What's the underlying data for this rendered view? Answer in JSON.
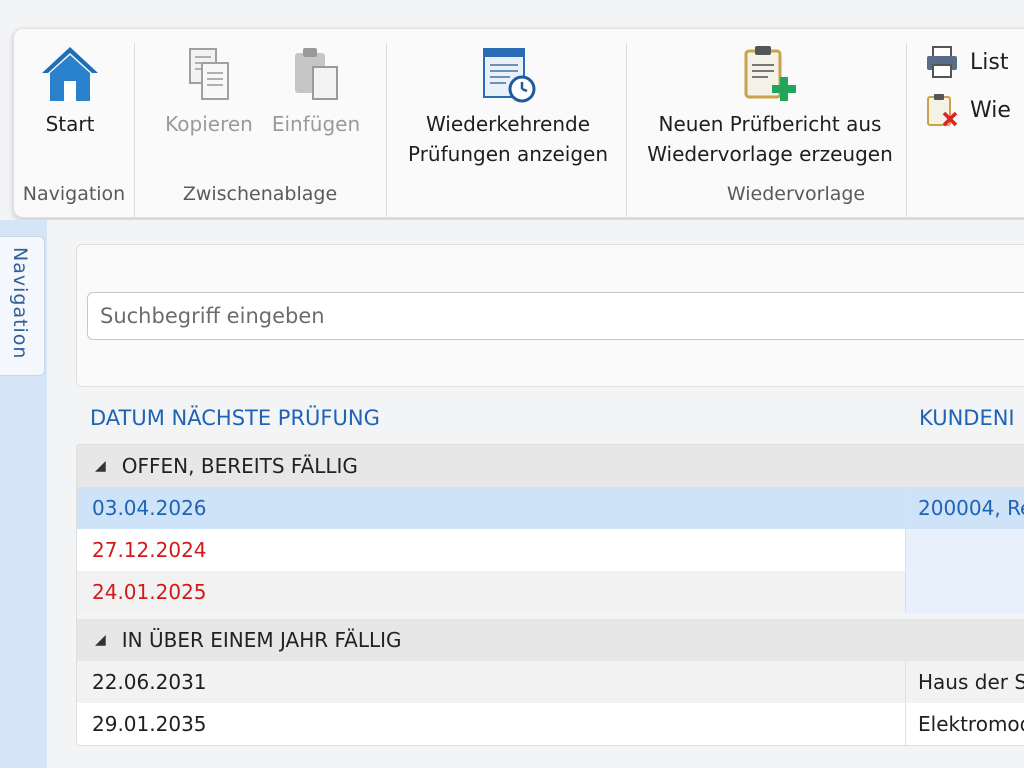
{
  "ribbon": {
    "start_label": "Start",
    "copy_label": "Kopieren",
    "paste_label": "Einfügen",
    "recurring_label_line1": "Wiederkehrende",
    "recurring_label_line2": "Prüfungen anzeigen",
    "new_report_line1": "Neuen Prüfbericht aus",
    "new_report_line2": "Wiedervorlage erzeugen",
    "list_label": "List",
    "wie_label": "Wie",
    "group_navigation": "Navigation",
    "group_clipboard": "Zwischenablage",
    "group_resubmission": "Wiedervorlage"
  },
  "side_nav": {
    "tab_label": "Navigation"
  },
  "search": {
    "placeholder": "Suchbegriff eingeben",
    "value": ""
  },
  "table": {
    "columns": [
      "DATUM NÄCHSTE PRÜFUNG",
      "KUNDENI"
    ],
    "groups": [
      {
        "label": "OFFEN, BEREITS FÄLLIG",
        "rows": [
          {
            "date": "03.04.2026",
            "customer": "200004, Re"
          },
          {
            "date": "27.12.2024",
            "customer": ""
          },
          {
            "date": "24.01.2025",
            "customer": ""
          }
        ]
      },
      {
        "label": "IN ÜBER EINEM JAHR FÄLLIG",
        "rows": [
          {
            "date": "22.06.2031",
            "customer": "Haus der S"
          },
          {
            "date": "29.01.2035",
            "customer": "Elektromod"
          }
        ]
      }
    ]
  },
  "colors": {
    "accent_blue": "#1f63b5",
    "overdue_red": "#d11a1a",
    "selected_row": "#cfe3f8",
    "nav_strip": "#d6e4f7"
  }
}
